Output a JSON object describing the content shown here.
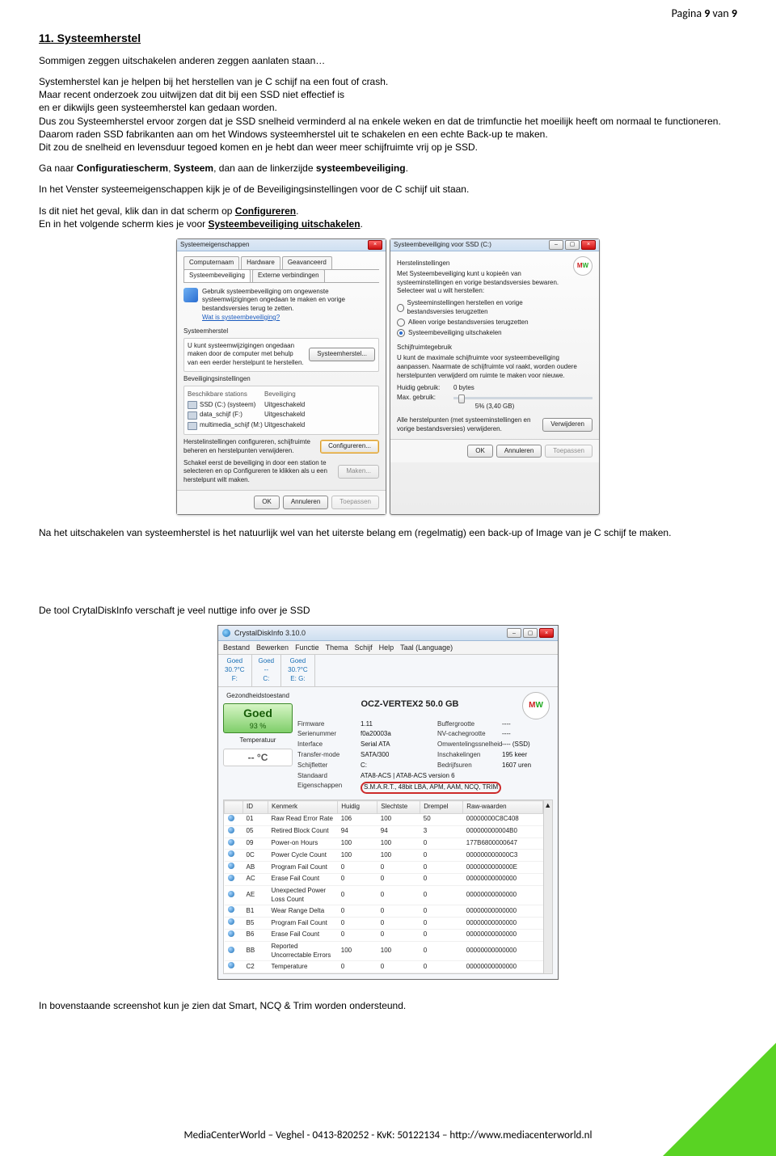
{
  "page_num": {
    "prefix": "Pagina ",
    "cur": "9",
    "mid": " van ",
    "total": "9"
  },
  "section_title": "11. Systeemherstel",
  "para1": "Sommigen zeggen uitschakelen anderen zeggen aanlaten staan…",
  "para2": "Systemherstel kan je helpen bij het herstellen van je C schijf na een fout of crash.",
  "para3": "Maar recent onderzoek zou uitwijzen dat dit bij een SSD niet effectief is",
  "para4": "en er dikwijls geen systeemherstel kan gedaan worden.",
  "para5": "Dus zou Systeemherstel ervoor zorgen dat je SSD snelheid verminderd al na enkele weken en dat de trimfunctie het moeilijk heeft om normaal te functioneren.",
  "para6": "Daarom raden SSD fabrikanten aan om het Windows systeemherstel uit te schakelen en een echte Back-up te maken.",
  "para7": "Dit zou de snelheid en levensduur tegoed komen en je hebt dan weer meer schijfruimte vrij op je SSD.",
  "para8_a": "Ga naar ",
  "para8_b": "Configuratiescherm",
  "para8_c": ", ",
  "para8_d": "Systeem",
  "para8_e": ", dan aan de linkerzijde ",
  "para8_f": "systeembeveiliging",
  "para8_g": ".",
  "para9": "In het Venster systeemeigenschappen kijk je of de Beveiligingsinstellingen voor de C schijf uit staan.",
  "para10_a": "Is dit niet het geval, klik dan in dat scherm op ",
  "para10_b": "Configureren",
  "para10_c": ".",
  "para11_a": "En in het volgende scherm kies je voor ",
  "para11_b": "Systeembeveiliging uitschakelen",
  "para11_c": ".",
  "after1": "Na het uitschakelen van systeemherstel is het natuurlijk wel van het uiterste belang em (regelmatig) een back-up of Image van je C schijf te maken.",
  "tooltext": "De tool CrytalDiskInfo verschaft je veel nuttige info over je SSD",
  "closing": "In bovenstaande screenshot kun je zien dat Smart, NCQ & Trim worden ondersteund.",
  "footer": "MediaCenterWorld – Veghel - 0413-820252 - KvK: 50122134 – http://www.mediacenterworld.nl",
  "syseig": {
    "title": "Systeemeigenschappen",
    "tabs": [
      "Computernaam",
      "Hardware",
      "Geavanceerd",
      "Systeembeveiliging",
      "Externe verbindingen"
    ],
    "desc": "Gebruik systeembeveiliging om ongewenste systeemwijzigingen ongedaan te maken en vorige bestandsversies terug te zetten.",
    "link": "Wat is systeembeveiliging?",
    "sh_title": "Systeemherstel",
    "sh_desc": "U kunt systeemwijzigingen ongedaan maken door de computer met behulp van een eerder herstelpunt te herstellen.",
    "sh_btn": "Systeemherstel...",
    "bi_title": "Beveiligingsinstellingen",
    "col1": "Beschikbare stations",
    "col2": "Beveiliging",
    "drives": [
      {
        "name": "SSD (C:) (systeem)",
        "state": "Uitgeschakeld"
      },
      {
        "name": "data_schijf (F:)",
        "state": "Uitgeschakeld"
      },
      {
        "name": "multimedia_schijf (M:)",
        "state": "Uitgeschakeld"
      }
    ],
    "conf_desc": "Herstelinstellingen configureren, schijfruimte beheren en herstelpunten verwijderen.",
    "conf_btn": "Configureren...",
    "make_desc": "Schakel eerst de beveiliging in door een station te selecteren en op Configureren te klikken als u een herstelpunt wilt maken.",
    "make_btn": "Maken...",
    "ok": "OK",
    "cancel": "Annuleren",
    "apply": "Toepassen"
  },
  "sysbev": {
    "title": "Systeembeveiliging voor SSD (C:)",
    "sec1": "Herstelinstellingen",
    "desc": "Met Systeembeveiliging kunt u kopieën van systeeminstellingen en vorige bestandsversies bewaren. Selecteer wat u wilt herstellen:",
    "r1": "Systeeminstellingen herstellen en vorige bestandsversies terugzetten",
    "r2": "Alleen vorige bestandsversies terugzetten",
    "r3": "Systeembeveiliging uitschakelen",
    "sec2": "Schijfruimtegebruik",
    "space_desc": "U kunt de maximale schijfruimte voor systeembeveiliging aanpassen. Naarmate de schijfruimte vol raakt, worden oudere herstelpunten verwijderd om ruimte te maken voor nieuwe.",
    "cur_lab": "Huidig gebruik:",
    "cur_val": "0 bytes",
    "max_lab": "Max. gebruik:",
    "slider_label": "5% (3,40 GB)",
    "del_desc": "Alle herstelpunten (met systeeminstellingen en vorige bestandsversies) verwijderen.",
    "del_btn": "Verwijderen",
    "ok": "OK",
    "cancel": "Annuleren",
    "apply": "Toepassen"
  },
  "cdi": {
    "title": "CrystalDiskInfo 3.10.0",
    "menu": [
      "Bestand",
      "Bewerken",
      "Functie",
      "Thema",
      "Schijf",
      "Help",
      "Taal (Language)"
    ],
    "disks": [
      {
        "status": "Goed",
        "temp": "30.?°C",
        "letter": "F:"
      },
      {
        "status": "Goed",
        "temp": "--",
        "letter": "C:"
      },
      {
        "status": "Goed",
        "temp": "30.?°C",
        "letter": "E: G:"
      }
    ],
    "health_label": "Gezondheidstoestand",
    "health_status": "Goed",
    "health_pct": "93 %",
    "temp_label": "Temperatuur",
    "temp_val": "-- °C",
    "model": "OCZ-VERTEX2  50.0 GB",
    "rowsL": [
      {
        "k": "Firmware",
        "v": "1.11"
      },
      {
        "k": "Serienummer",
        "v": "f0a20003a"
      },
      {
        "k": "Interface",
        "v": "Serial ATA"
      },
      {
        "k": "Transfer-mode",
        "v": "SATA/300"
      },
      {
        "k": "Schijfletter",
        "v": "C:"
      },
      {
        "k": "Standaard",
        "v": "ATA8-ACS | ATA8-ACS version 6"
      },
      {
        "k": "Eigenschappen",
        "v": "S.M.A.R.T., 48bit LBA, APM, AAM, NCQ, TRIM"
      }
    ],
    "rowsR": [
      {
        "k": "Buffergrootte",
        "v": "----"
      },
      {
        "k": "NV-cachegrootte",
        "v": "----"
      },
      {
        "k": "Omwentelingssnelheid",
        "v": "---- (SSD)"
      },
      {
        "k": "Inschakelingen",
        "v": "195 keer"
      },
      {
        "k": "Bedrijfsuren",
        "v": "1607 uren"
      }
    ],
    "cols": [
      "",
      "ID",
      "Kenmerk",
      "Huidig",
      "Slechtste",
      "Drempel",
      "Raw-waarden"
    ],
    "smart": [
      {
        "id": "01",
        "name": "Raw Read Error Rate",
        "h": "106",
        "s": "100",
        "d": "50",
        "r": "00000000C8C408"
      },
      {
        "id": "05",
        "name": "Retired Block Count",
        "h": "94",
        "s": "94",
        "d": "3",
        "r": "000000000004B0"
      },
      {
        "id": "09",
        "name": "Power-on Hours",
        "h": "100",
        "s": "100",
        "d": "0",
        "r": "177B6800000647"
      },
      {
        "id": "0C",
        "name": "Power Cycle Count",
        "h": "100",
        "s": "100",
        "d": "0",
        "r": "000000000000C3"
      },
      {
        "id": "AB",
        "name": "Program Fail Count",
        "h": "0",
        "s": "0",
        "d": "0",
        "r": "0000000000000E"
      },
      {
        "id": "AC",
        "name": "Erase Fail Count",
        "h": "0",
        "s": "0",
        "d": "0",
        "r": "00000000000000"
      },
      {
        "id": "AE",
        "name": "Unexpected Power Loss Count",
        "h": "0",
        "s": "0",
        "d": "0",
        "r": "00000000000000"
      },
      {
        "id": "B1",
        "name": "Wear Range Delta",
        "h": "0",
        "s": "0",
        "d": "0",
        "r": "00000000000000"
      },
      {
        "id": "B5",
        "name": "Program Fail Count",
        "h": "0",
        "s": "0",
        "d": "0",
        "r": "00000000000000"
      },
      {
        "id": "B6",
        "name": "Erase Fail Count",
        "h": "0",
        "s": "0",
        "d": "0",
        "r": "00000000000000"
      },
      {
        "id": "BB",
        "name": "Reported Uncorrectable Errors",
        "h": "100",
        "s": "100",
        "d": "0",
        "r": "00000000000000"
      },
      {
        "id": "C2",
        "name": "Temperature",
        "h": "0",
        "s": "0",
        "d": "0",
        "r": "00000000000000"
      }
    ]
  }
}
